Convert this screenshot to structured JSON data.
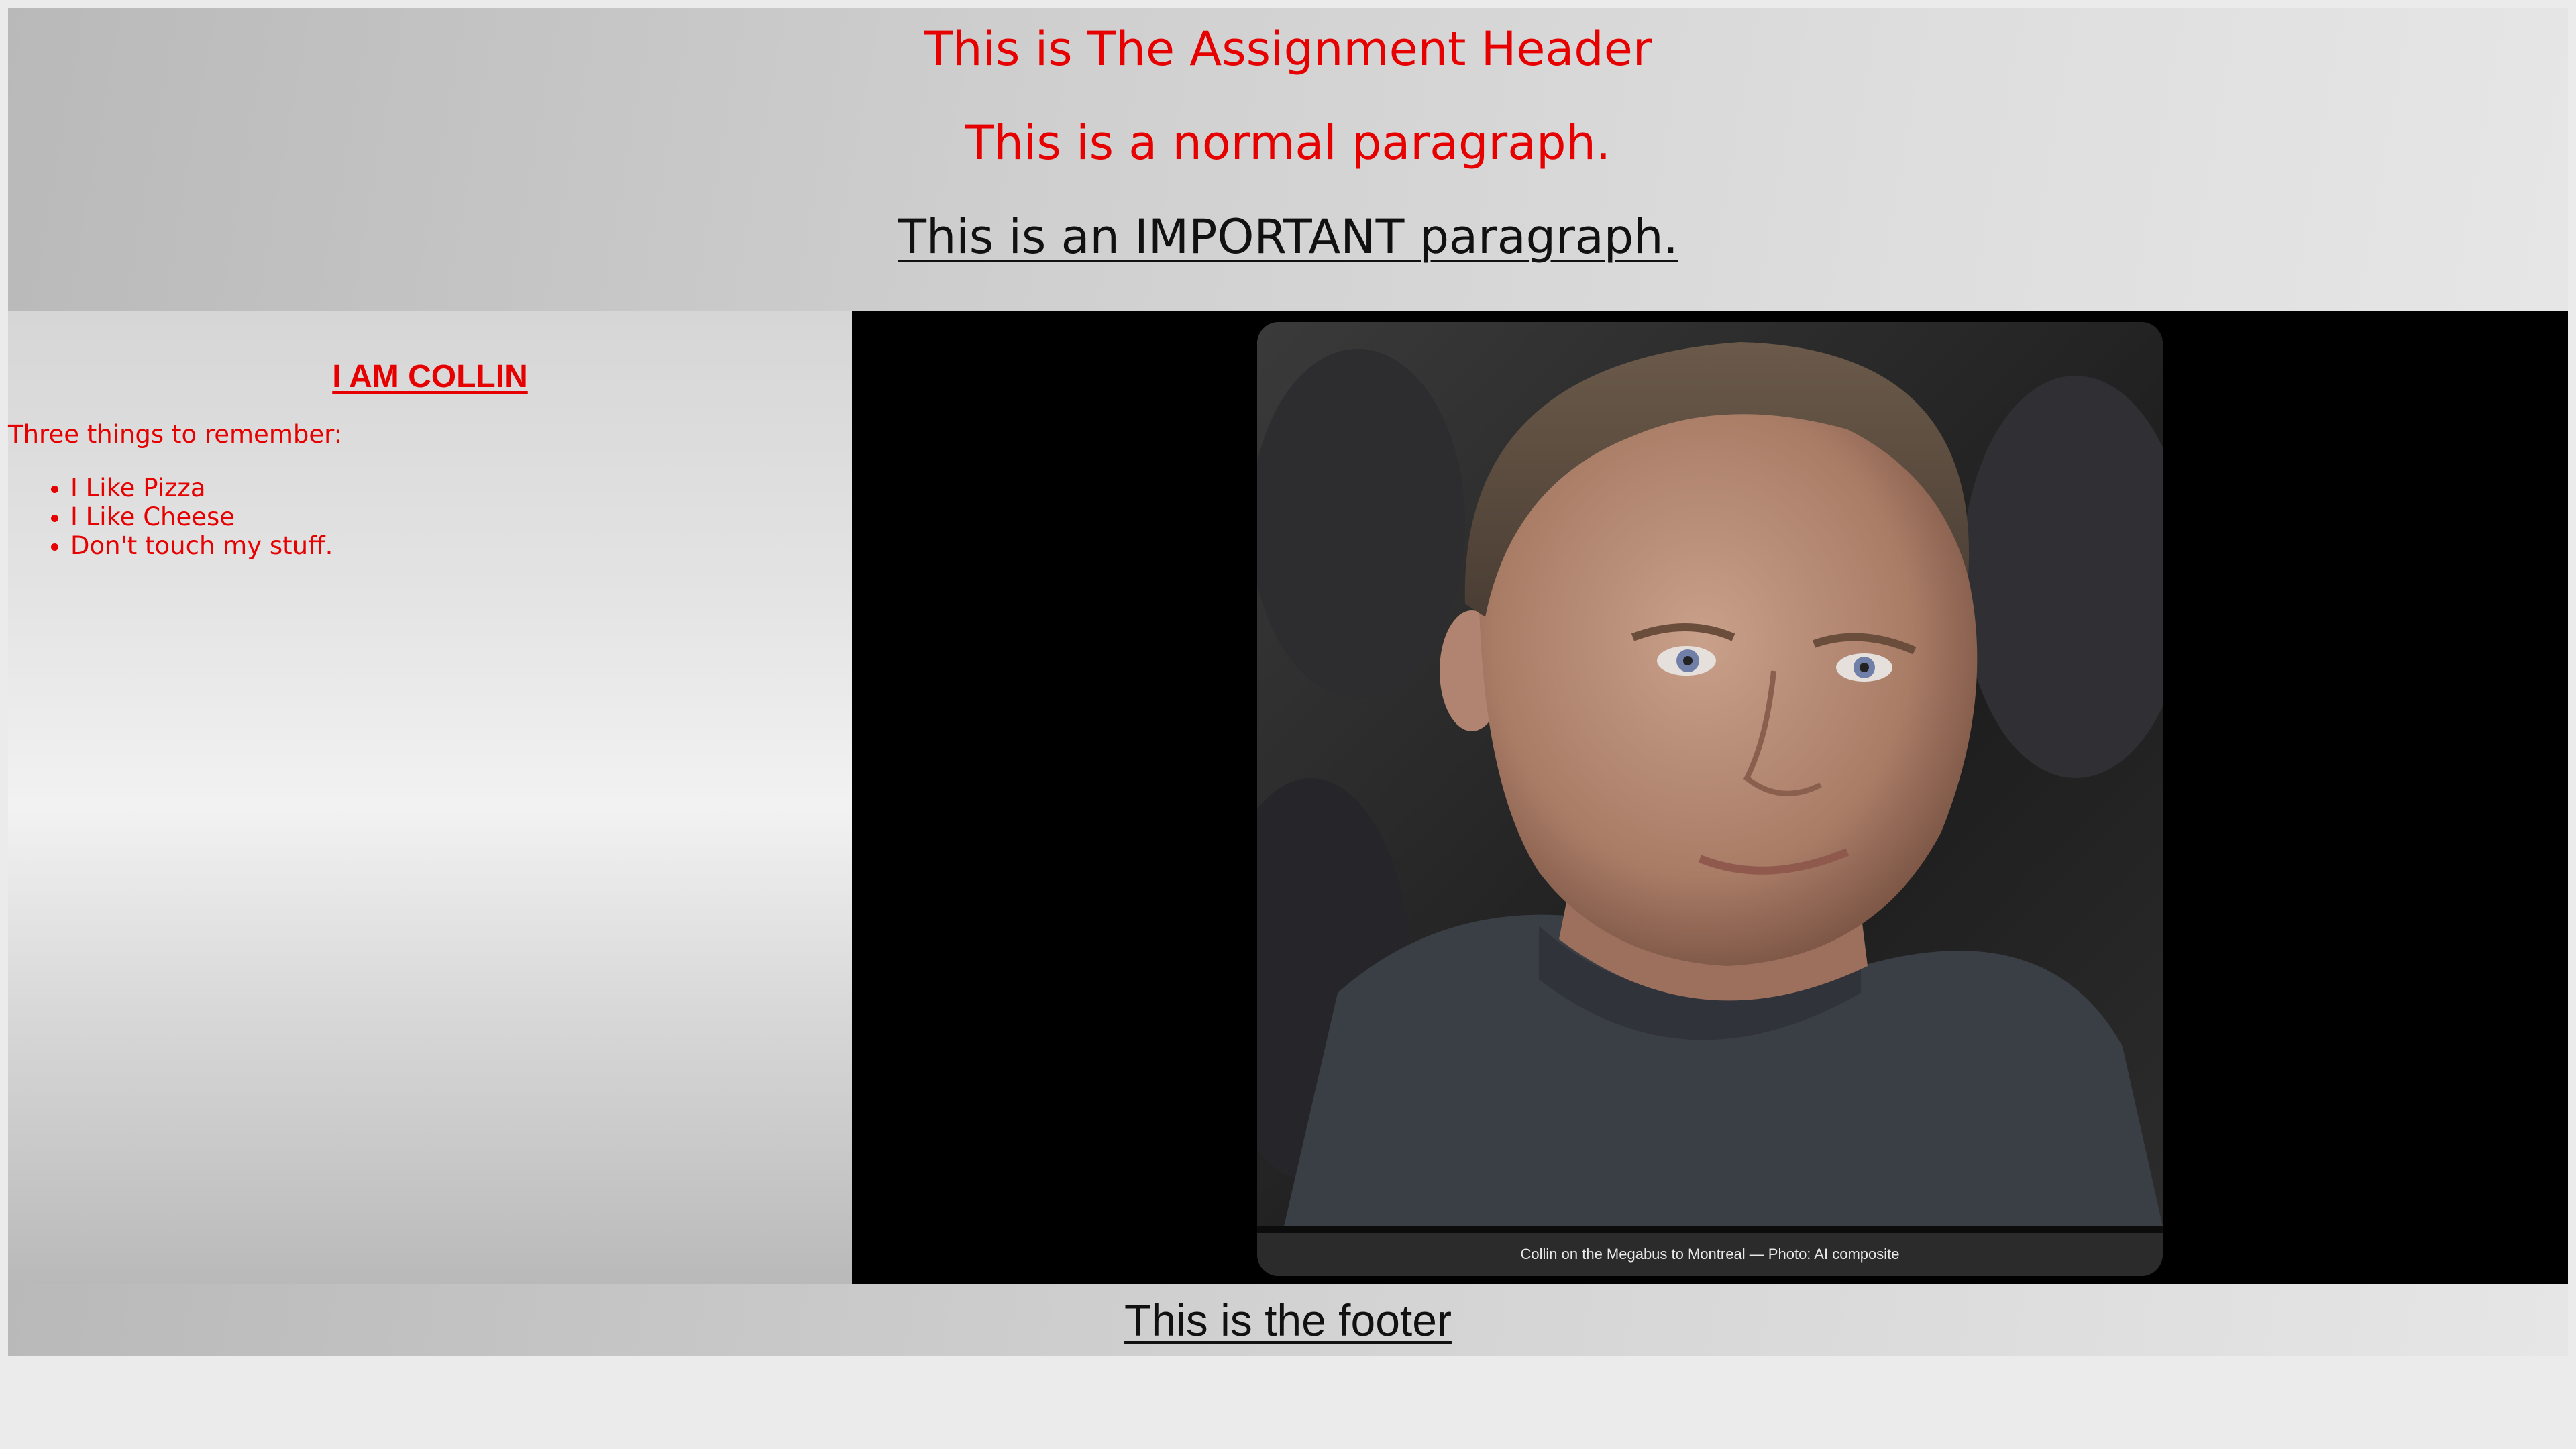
{
  "header": {
    "title": "This is The Assignment Header",
    "normal_paragraph": "This is a normal paragraph.",
    "important_paragraph": "This is an IMPORTANT paragraph."
  },
  "sidebar": {
    "name": "I AM COLLIN",
    "intro": "Three things to remember:",
    "items": [
      "I Like Pizza",
      "I Like Cheese",
      "Don't touch my stuff."
    ]
  },
  "main": {
    "photo_caption": "Collin on the Megabus to Montreal — Photo: AI composite"
  },
  "footer": {
    "text": "This is the footer"
  },
  "colors": {
    "accent_red": "#e60000",
    "main_background": "#000000"
  }
}
